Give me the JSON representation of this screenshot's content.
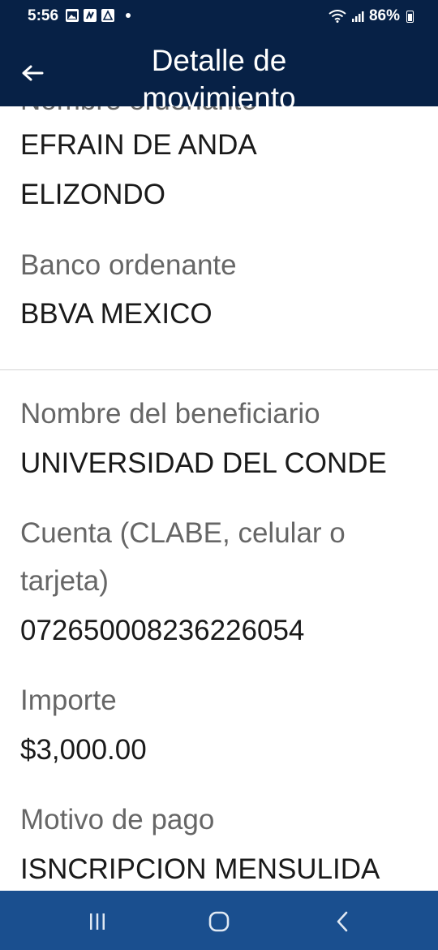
{
  "status_bar": {
    "time": "5:56",
    "battery": "86%",
    "icons": [
      "gallery-icon",
      "app-icon",
      "alert-icon",
      "dot-icon",
      "wifi-icon",
      "signal-icon",
      "battery-icon"
    ]
  },
  "header": {
    "title": "Detalle de movimiento",
    "back_icon": "back-arrow-icon",
    "background": "#072146"
  },
  "details": {
    "ordenante_label": "Nombre ordenante",
    "ordenante_line1": "EFRAIN DE ANDA",
    "ordenante_line2": "ELIZONDO",
    "banco_label": "Banco ordenante",
    "banco_value": "BBVA MEXICO",
    "beneficiario_label": "Nombre del beneficiario",
    "beneficiario_value": "UNIVERSIDAD DEL CONDE",
    "cuenta_label_line1": "Cuenta (CLABE, celular o",
    "cuenta_label_line2": "tarjeta)",
    "cuenta_value": "072650008236226054",
    "importe_label": "Importe",
    "importe_value": "$3,000.00",
    "motivo_label": "Motivo de pago",
    "motivo_value": "ISNCRIPCION MENSULIDA"
  },
  "nav_bar": {
    "background": "#1a4f8f",
    "icons": [
      "recent-apps-icon",
      "home-icon",
      "back-icon"
    ]
  }
}
